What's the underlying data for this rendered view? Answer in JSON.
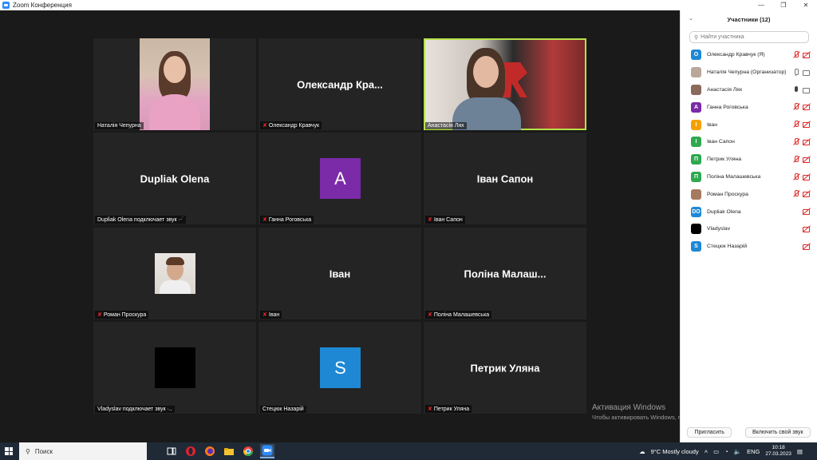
{
  "window": {
    "title": "Zoom Конференция",
    "controls": [
      "—",
      "❐",
      "✕"
    ]
  },
  "tiles": [
    {
      "name": "Наталія Чепурна",
      "big_name": "",
      "muted": false,
      "kind": "video-natalia"
    },
    {
      "name": "Олександр Кравчук",
      "big_name": "Олександр  Кра...",
      "muted": true,
      "kind": "name"
    },
    {
      "name": "Анастасія Лях",
      "big_name": "",
      "muted": false,
      "kind": "video-anastasia",
      "active": true
    },
    {
      "name": "Dupliak Olena подключает звук ·⋅˙",
      "big_name": "Dupliak Olena",
      "muted": false,
      "kind": "name"
    },
    {
      "name": "Ганна Роговська",
      "big_name": "",
      "muted": true,
      "kind": "avatar",
      "letter": "A",
      "color": "#7b2aa8"
    },
    {
      "name": "Іван Сапон",
      "big_name": "Іван Сапон",
      "muted": true,
      "kind": "name"
    },
    {
      "name": "Роман Проскура",
      "big_name": "",
      "muted": true,
      "kind": "photo-roman"
    },
    {
      "name": "Іван",
      "big_name": "Іван",
      "muted": true,
      "kind": "name"
    },
    {
      "name": "Поліна Малашевська",
      "big_name": "Поліна  Малаш...",
      "muted": true,
      "kind": "name"
    },
    {
      "name": "Vladyslav подключает звук ·..",
      "big_name": "",
      "muted": false,
      "kind": "avatar",
      "letter": "",
      "color": "#000000"
    },
    {
      "name": "Стецюк Назарій",
      "big_name": "",
      "muted": false,
      "kind": "avatar",
      "letter": "S",
      "color": "#1e88d4"
    },
    {
      "name": "Петрик Уляна",
      "big_name": "Петрик Уляна",
      "muted": true,
      "kind": "name"
    }
  ],
  "watermark": {
    "line1": "Активация Windows",
    "line2": "Чтобы активировать Windows, перейдите в раздел \"Параметры\"."
  },
  "panel": {
    "title": "Участники  (12)",
    "search_placeholder": "Найти участника",
    "invite_label": "Пригласить",
    "unmute_label": "Включить свой звук",
    "participants": [
      {
        "name": "Олександр Кравчук (Я)",
        "letter": "О",
        "color": "#1e88d4",
        "mic": "off",
        "cam": "off"
      },
      {
        "name": "Наталія Чепурна (Организатор)",
        "letter": "",
        "color": "#b9a79a",
        "mic": "on",
        "cam": "on"
      },
      {
        "name": "Анастасія Лях",
        "letter": "",
        "color": "#8a6a5a",
        "mic": "dark",
        "cam": "on"
      },
      {
        "name": "Ганна Роговська",
        "letter": "A",
        "color": "#7b2aa8",
        "mic": "off",
        "cam": "off"
      },
      {
        "name": "Іван",
        "letter": "І",
        "color": "#f5a000",
        "mic": "off",
        "cam": "off"
      },
      {
        "name": "Іван Сапон",
        "letter": "І",
        "color": "#2fa84f",
        "mic": "off",
        "cam": "off"
      },
      {
        "name": "Петрик Уляна",
        "letter": "П",
        "color": "#2fa84f",
        "mic": "off",
        "cam": "off"
      },
      {
        "name": "Поліна Малашевська",
        "letter": "П",
        "color": "#2fa84f",
        "mic": "off",
        "cam": "off"
      },
      {
        "name": "Роман Проскура",
        "letter": "",
        "color": "#a57a60",
        "mic": "off",
        "cam": "off"
      },
      {
        "name": "Dupliak Olena",
        "letter": "DO",
        "color": "#1e88d4",
        "mic": "none",
        "cam": "off"
      },
      {
        "name": "Vladyslav",
        "letter": "",
        "color": "#000000",
        "mic": "none",
        "cam": "off"
      },
      {
        "name": "Стецюк Назарій",
        "letter": "S",
        "color": "#1e88d4",
        "mic": "none",
        "cam": "off"
      }
    ]
  },
  "taskbar": {
    "search_label": "Поиск",
    "weather": "9°C  Mostly cloudy",
    "lang": "ENG",
    "time": "10:18",
    "date": "27.03.2023"
  }
}
